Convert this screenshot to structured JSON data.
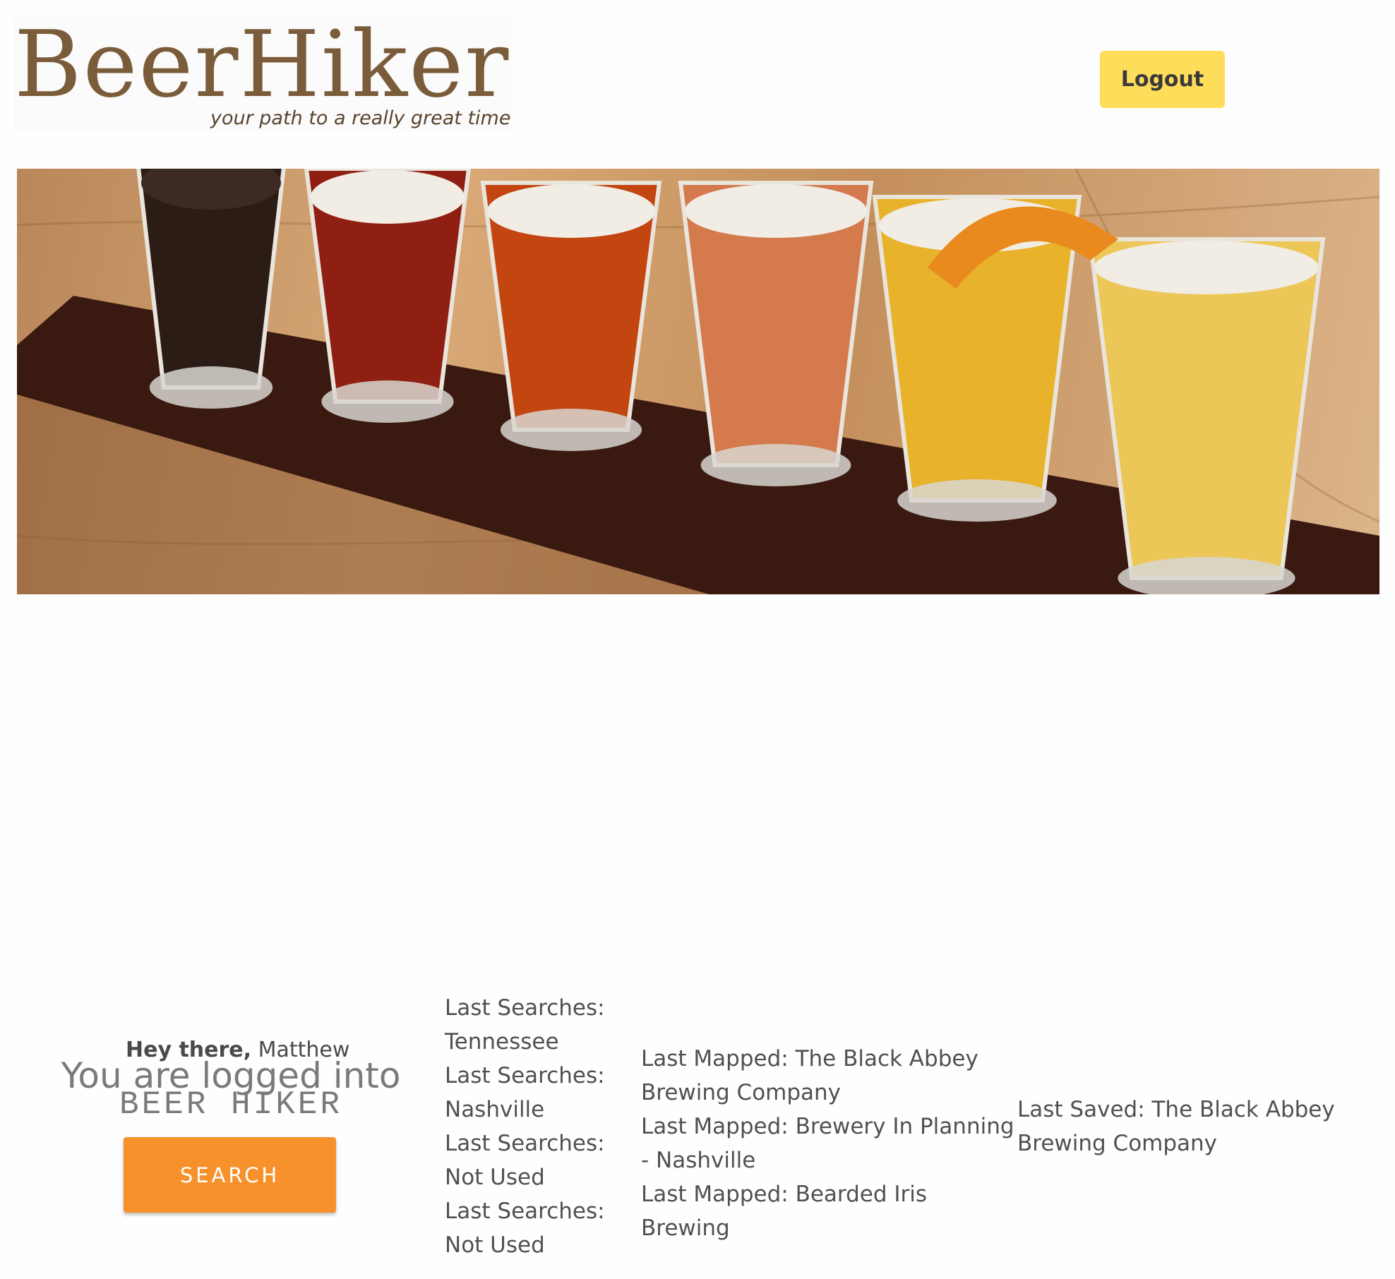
{
  "header": {
    "logo_title": "BeerHiker",
    "logo_tagline": "your path to a really great time",
    "logout_label": "Logout"
  },
  "hero": {
    "glasses": [
      {
        "color": "#2b1c16"
      },
      {
        "color": "#8e1f12"
      },
      {
        "color": "#c3450f"
      },
      {
        "color": "#d47a4c"
      },
      {
        "color": "#e8b22a"
      },
      {
        "color": "#ecc758"
      }
    ]
  },
  "user": {
    "greeting_label": "Hey there,",
    "name": "Matthew",
    "logged_in_text": "You are logged into",
    "brand_text": "BEER HIKER",
    "search_label": "SEARCH"
  },
  "last_searches": [
    "Last Searches: Tennessee",
    "Last Searches: Nashville",
    "Last Searches: Not Used",
    "Last Searches: Not Used"
  ],
  "last_mapped": [
    "Last Mapped: The Black Abbey Brewing Company",
    "Last Mapped: Brewery In Planning - Nashville",
    "Last Mapped: Bearded Iris Brewing"
  ],
  "last_saved": [
    "Last Saved: The Black Abbey Brewing Company"
  ],
  "colors": {
    "logout_bg": "#fedd5a",
    "search_bg": "#f7912b",
    "logo_brown": "#7b5c3a"
  }
}
